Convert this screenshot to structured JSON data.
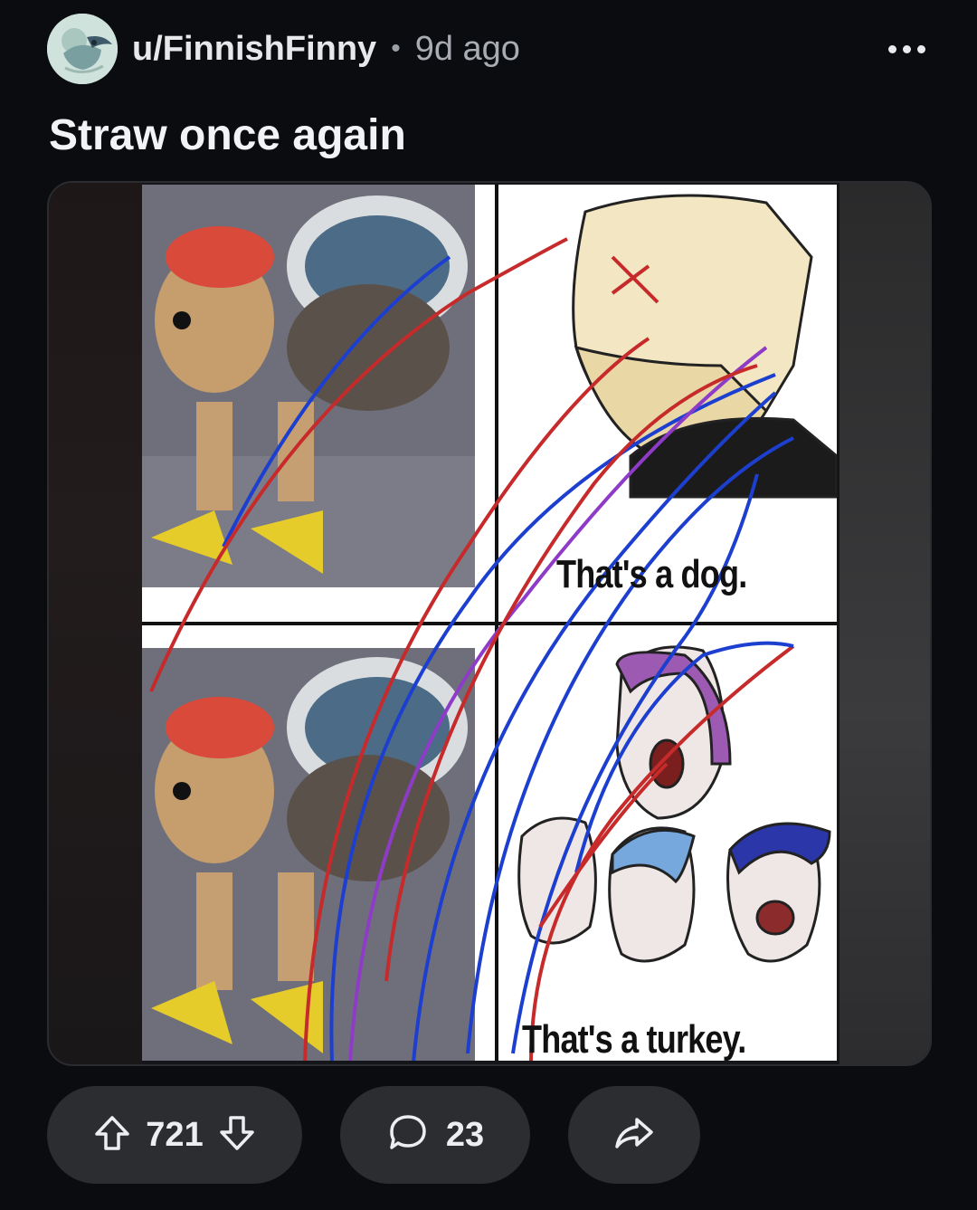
{
  "post": {
    "author": "u/FinnishFinny",
    "separator": "•",
    "time_ago": "9d ago",
    "title": "Straw once again"
  },
  "meme": {
    "caption_top": "That's a dog.",
    "caption_bottom": "That's a turkey."
  },
  "actions": {
    "vote_count": "721",
    "comment_count": "23"
  },
  "colors": {
    "background": "#0b0c0f",
    "pill": "#2b2d31",
    "text": "#e9ecef"
  },
  "icons": [
    "more-options-icon",
    "upvote-icon",
    "downvote-icon",
    "comment-icon",
    "share-icon"
  ]
}
